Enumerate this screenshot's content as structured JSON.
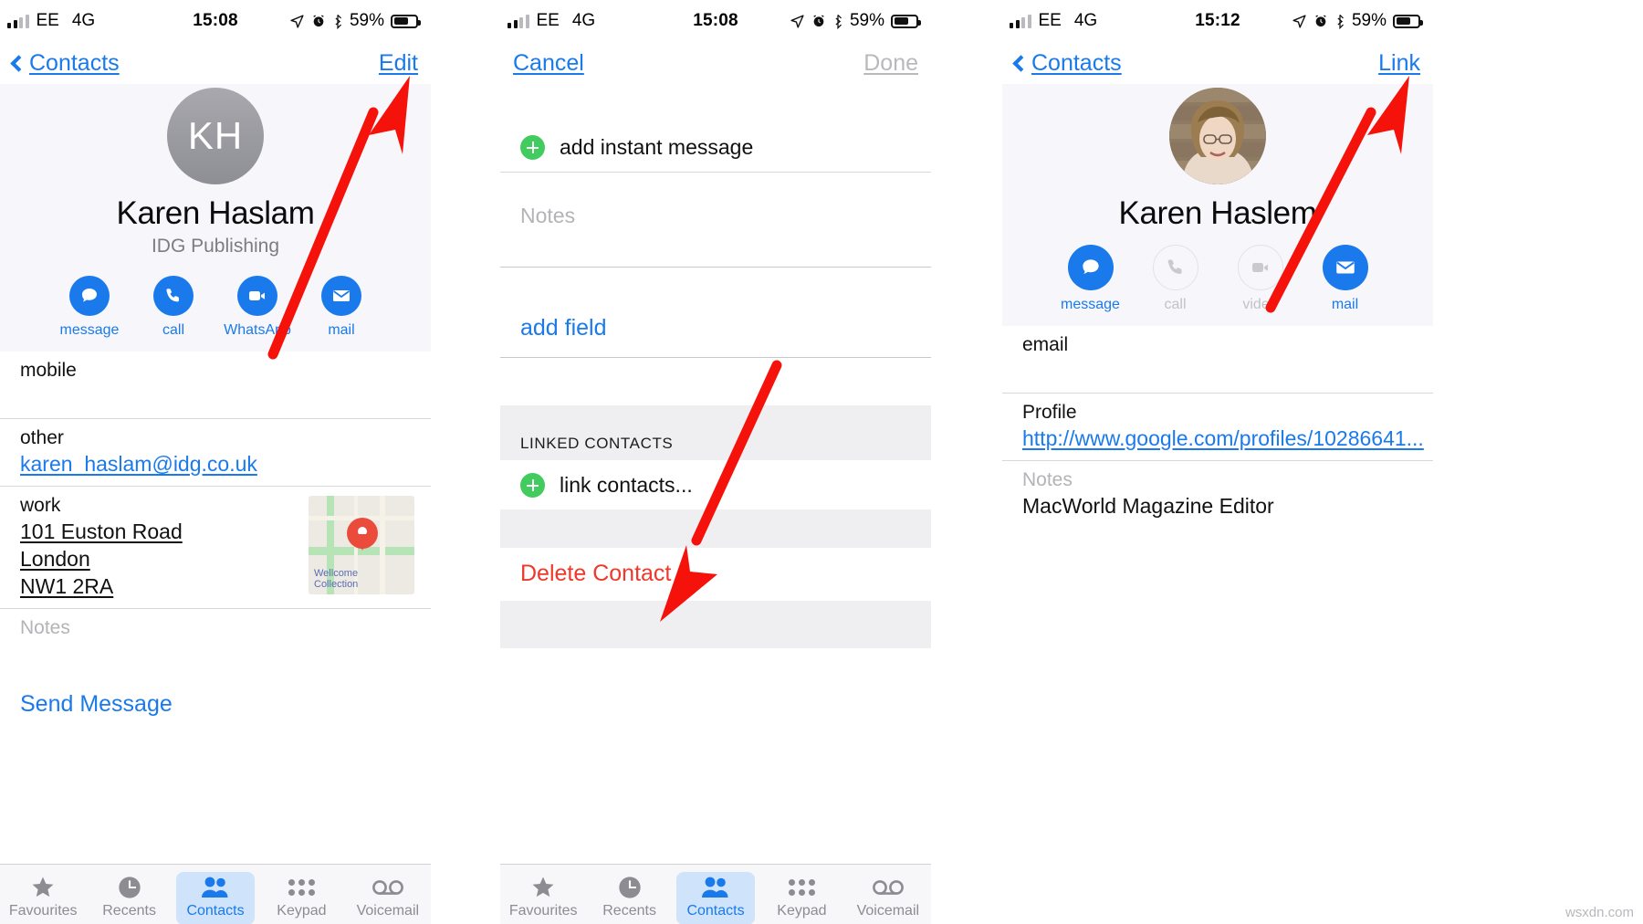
{
  "panels": [
    {
      "status": {
        "carrier": "EE",
        "network": "4G",
        "time": "15:08",
        "battery_pct": "59%"
      },
      "nav": {
        "back_label": "Contacts",
        "action_label": "Edit"
      },
      "contact": {
        "initials": "KH",
        "name": "Karen Haslam",
        "org": "IDG Publishing",
        "actions": [
          {
            "label": "message",
            "icon": "message-bubble-icon"
          },
          {
            "label": "call",
            "icon": "phone-icon"
          },
          {
            "label": "WhatsApp",
            "icon": "video-camera-icon"
          },
          {
            "label": "mail",
            "icon": "envelope-icon"
          }
        ]
      },
      "fields": [
        {
          "label": "mobile",
          "value": "",
          "kind": "redacted"
        },
        {
          "label": "other",
          "value": "karen_haslam@idg.co.uk",
          "kind": "link"
        },
        {
          "label": "work",
          "value": "101 Euston Road\nLondon\nNW1 2RA",
          "kind": "address",
          "map_label": "Wellcome\nCollection"
        },
        {
          "label": "Notes",
          "value": "",
          "kind": "placeholder"
        }
      ],
      "send_message": "Send Message"
    },
    {
      "status": {
        "carrier": "EE",
        "network": "4G",
        "time": "15:08",
        "battery_pct": "59%"
      },
      "nav": {
        "back_label": "Cancel",
        "action_label": "Done",
        "action_disabled": true
      },
      "rows": {
        "add_instant_message": "add instant message",
        "notes_placeholder": "Notes",
        "add_field": "add field",
        "linked_contacts_header": "LINKED CONTACTS",
        "link_contacts": "link contacts...",
        "delete_contact": "Delete Contact"
      }
    },
    {
      "status": {
        "carrier": "EE",
        "network": "4G",
        "time": "15:12",
        "battery_pct": "59%"
      },
      "nav": {
        "back_label": "Contacts",
        "action_label": "Link"
      },
      "contact": {
        "name": "Karen Haslem",
        "actions": [
          {
            "label": "message",
            "icon": "message-bubble-icon",
            "enabled": true
          },
          {
            "label": "call",
            "icon": "phone-icon",
            "enabled": false
          },
          {
            "label": "video",
            "icon": "video-camera-icon",
            "enabled": false
          },
          {
            "label": "mail",
            "icon": "envelope-icon",
            "enabled": true
          }
        ]
      },
      "fields": [
        {
          "label": "email",
          "value": "",
          "kind": "redacted"
        },
        {
          "label": "Profile",
          "value": "http://www.google.com/profiles/10286641...",
          "kind": "link"
        },
        {
          "label": "Notes",
          "value": "MacWorld Magazine Editor",
          "kind": "note"
        }
      ]
    }
  ],
  "tabbar": {
    "items": [
      {
        "label": "Favourites",
        "icon": "star-icon",
        "active": false
      },
      {
        "label": "Recents",
        "icon": "clock-icon",
        "active": false
      },
      {
        "label": "Contacts",
        "icon": "people-icon",
        "active": true
      },
      {
        "label": "Keypad",
        "icon": "keypad-dots-icon",
        "active": false
      },
      {
        "label": "Voicemail",
        "icon": "voicemail-icon",
        "active": false
      }
    ]
  },
  "annotations": {
    "arrow_color": "#f5120b",
    "count": 3
  },
  "watermark": "wsxdn.com"
}
